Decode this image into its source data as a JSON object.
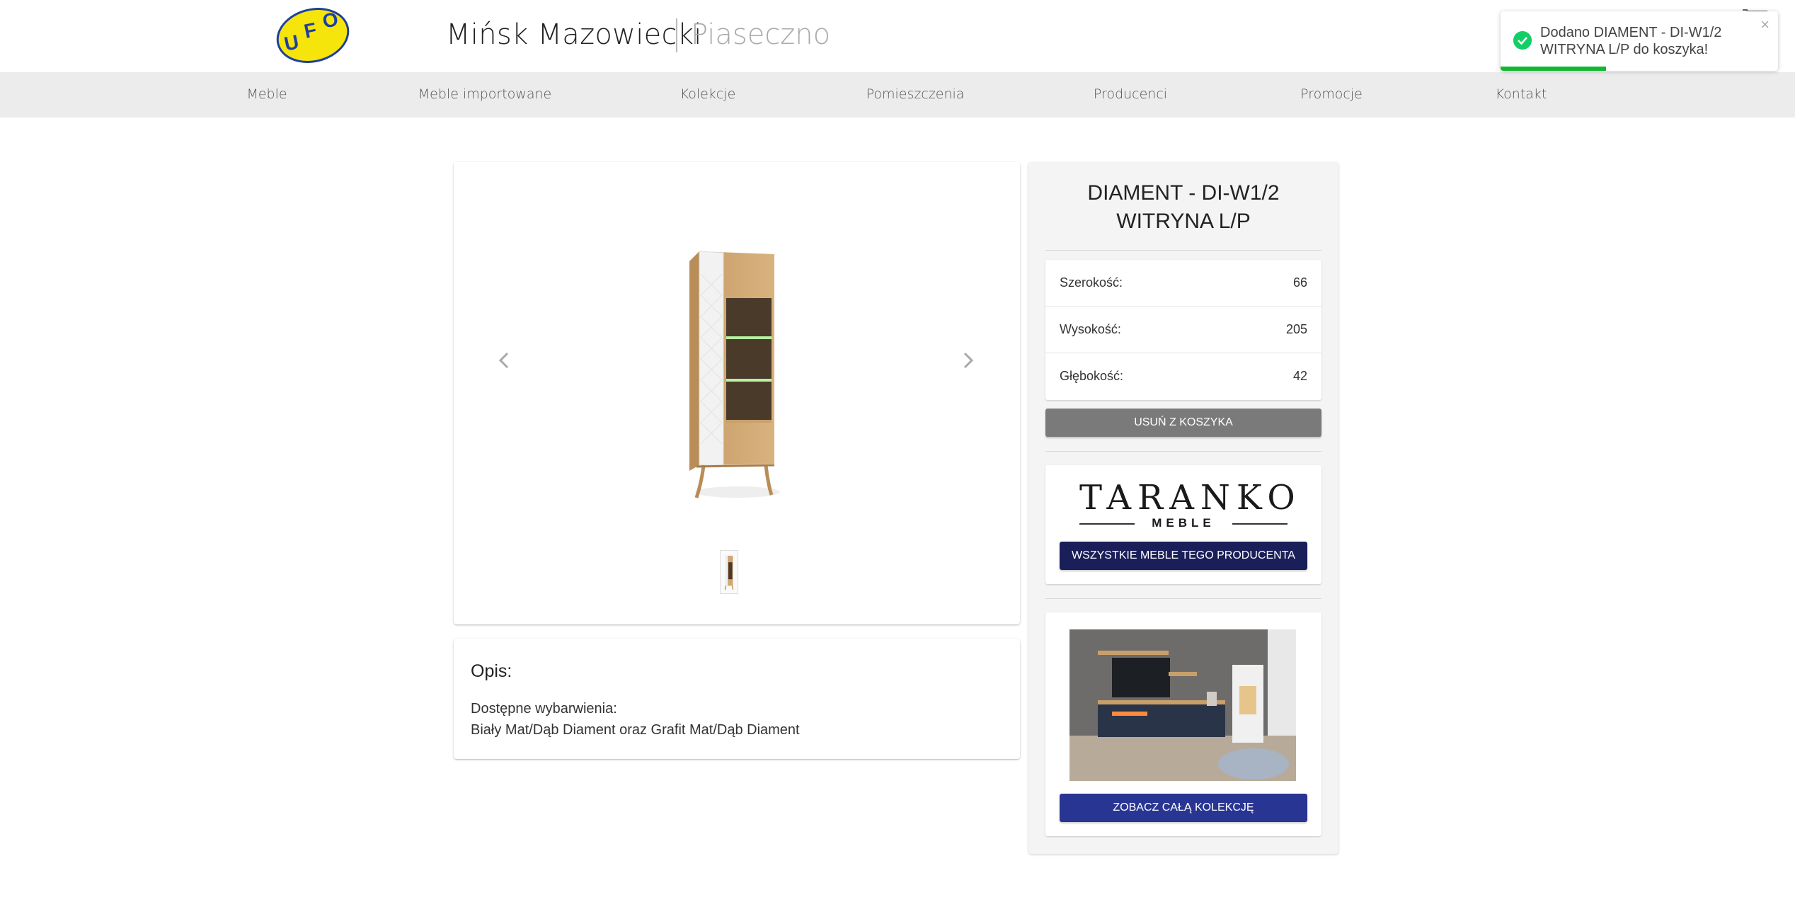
{
  "header": {
    "logo_text": "UFO",
    "city_main": "Mińsk Mazowiecki",
    "city_alt": "Piaseczno"
  },
  "nav": {
    "items": [
      "Meble",
      "Meble importowane",
      "Kolekcje",
      "Pomieszczenia",
      "Producenci",
      "Promocje",
      "Kontakt"
    ]
  },
  "gallery": {
    "prev_icon": "chevron-left-icon",
    "next_icon": "chevron-right-icon",
    "thumbnail_count": 1
  },
  "description": {
    "title": "Opis:",
    "line1": "Dostępne wybarwienia:",
    "line2": "Biały Mat/Dąb Diament oraz Grafit Mat/Dąb Diament"
  },
  "product": {
    "title_line1": "DIAMENT - DI-W1/2",
    "title_line2": "WITRYNA L/P",
    "specs": [
      {
        "label": "Szerokość:",
        "value": "66"
      },
      {
        "label": "Wysokość:",
        "value": "205"
      },
      {
        "label": "Głębokość:",
        "value": "42"
      }
    ],
    "remove_button": "USUŃ Z KOSZYKA"
  },
  "producer": {
    "name": "TARANKO",
    "sub": "MEBLE",
    "button": "WSZYSTKIE MEBLE TEGO PRODUCENTA"
  },
  "collection": {
    "button": "ZOBACZ CAŁĄ KOLEKCJĘ"
  },
  "toast": {
    "message": "Dodano DIAMENT - DI-W1/2 WITRYNA L/P do koszyka!",
    "close": "×",
    "progress": 0.38,
    "icon": "check-circle-icon",
    "accent": "#13ce66"
  },
  "colors": {
    "nav_bg": "#ececec",
    "producer_button": "#1a1f5a",
    "collection_button": "#283593",
    "remove_button": "#7a7a7a",
    "logo_yellow": "#f5e50a",
    "logo_blue": "#1d3fa0"
  }
}
